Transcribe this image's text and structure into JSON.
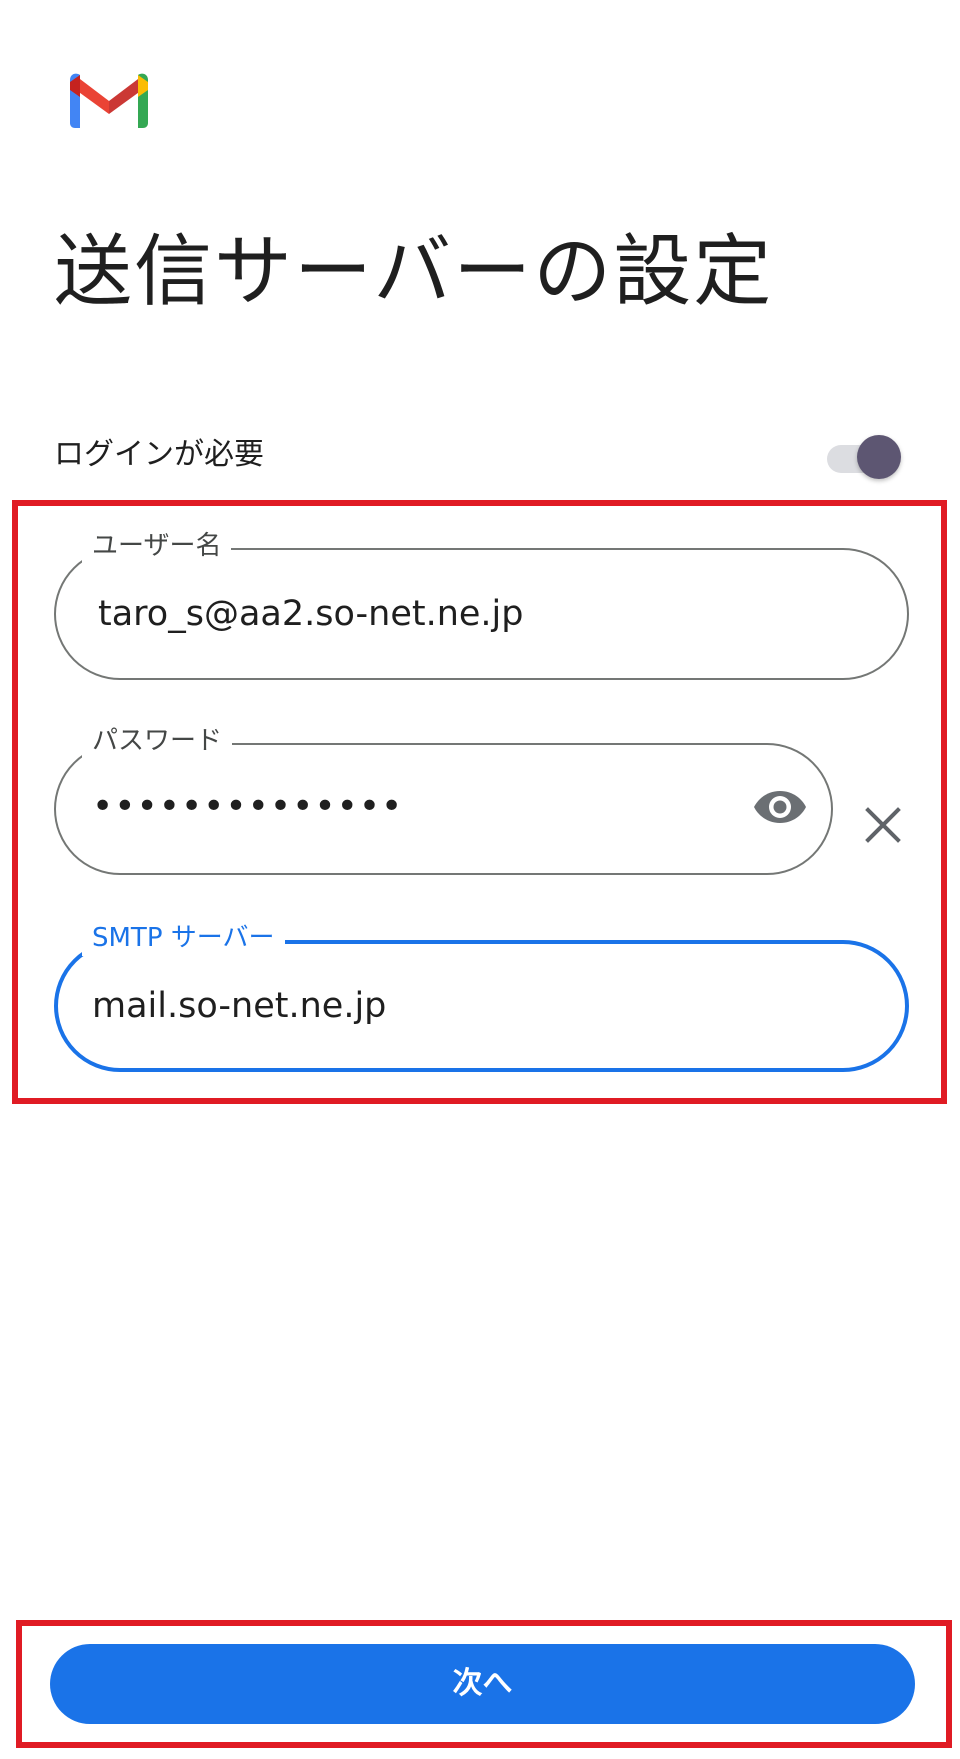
{
  "app": {
    "logo_icon": "gmail-logo-icon"
  },
  "header": {
    "title": "送信サーバーの設定"
  },
  "login_required": {
    "label": "ログインが必要",
    "enabled": true,
    "toggle_thumb_color": "#5d5672"
  },
  "form": {
    "username": {
      "label": "ユーザー名",
      "value": "taro_s@aa2.so-net.ne.jp"
    },
    "password": {
      "label": "パスワード",
      "value": "••••••••••••••",
      "show_icon": "eye-icon",
      "clear_icon": "close-icon"
    },
    "smtp_server": {
      "label": "SMTP サーバー",
      "value": "mail.so-net.ne.jp",
      "focused": true
    }
  },
  "footer": {
    "next_label": "次へ"
  },
  "colors": {
    "accent": "#1a73e8",
    "highlight": "#e01b24",
    "outline": "#747775"
  }
}
